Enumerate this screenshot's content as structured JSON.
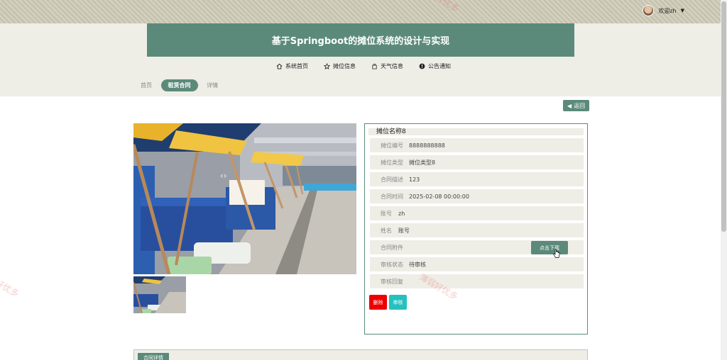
{
  "user": {
    "greeting": "欢迎zh"
  },
  "site_title": "基于Springboot的摊位系统的设计与实现",
  "nav": [
    {
      "label": "系统首页",
      "icon": "home-icon"
    },
    {
      "label": "摊位信息",
      "icon": "star-icon"
    },
    {
      "label": "天气信息",
      "icon": "bag-icon"
    },
    {
      "label": "公告通知",
      "icon": "info-icon"
    }
  ],
  "breadcrumbs": [
    "首页",
    "租赁合同",
    "详情"
  ],
  "back_label": "返回",
  "detail": {
    "title": "摊位名称8",
    "fields": [
      {
        "label": "摊位编号",
        "value": "8888888888"
      },
      {
        "label": "摊位类型",
        "value": "摊位类型8"
      },
      {
        "label": "合同描述",
        "value": "123"
      },
      {
        "label": "合同时间",
        "value": "2025-02-08 00:00:00"
      },
      {
        "label": "账号",
        "value": "zh"
      },
      {
        "label": "姓名",
        "value": "账号"
      },
      {
        "label": "合同附件",
        "value": ""
      },
      {
        "label": "审核状态",
        "value": "待审核"
      },
      {
        "label": "审核回复",
        "value": ""
      }
    ],
    "download_label": "点击下载",
    "delete_label": "删除",
    "audit_label": "审核"
  },
  "bottom_tab": "合同详情",
  "watermarks": [
    "薄弱好优多",
    "好优多",
    "薄弱好优多"
  ],
  "colors": {
    "accent": "#5b8a7a",
    "header_bg": "#eeede6",
    "delete": "#ee0000",
    "audit": "#26c1be"
  }
}
